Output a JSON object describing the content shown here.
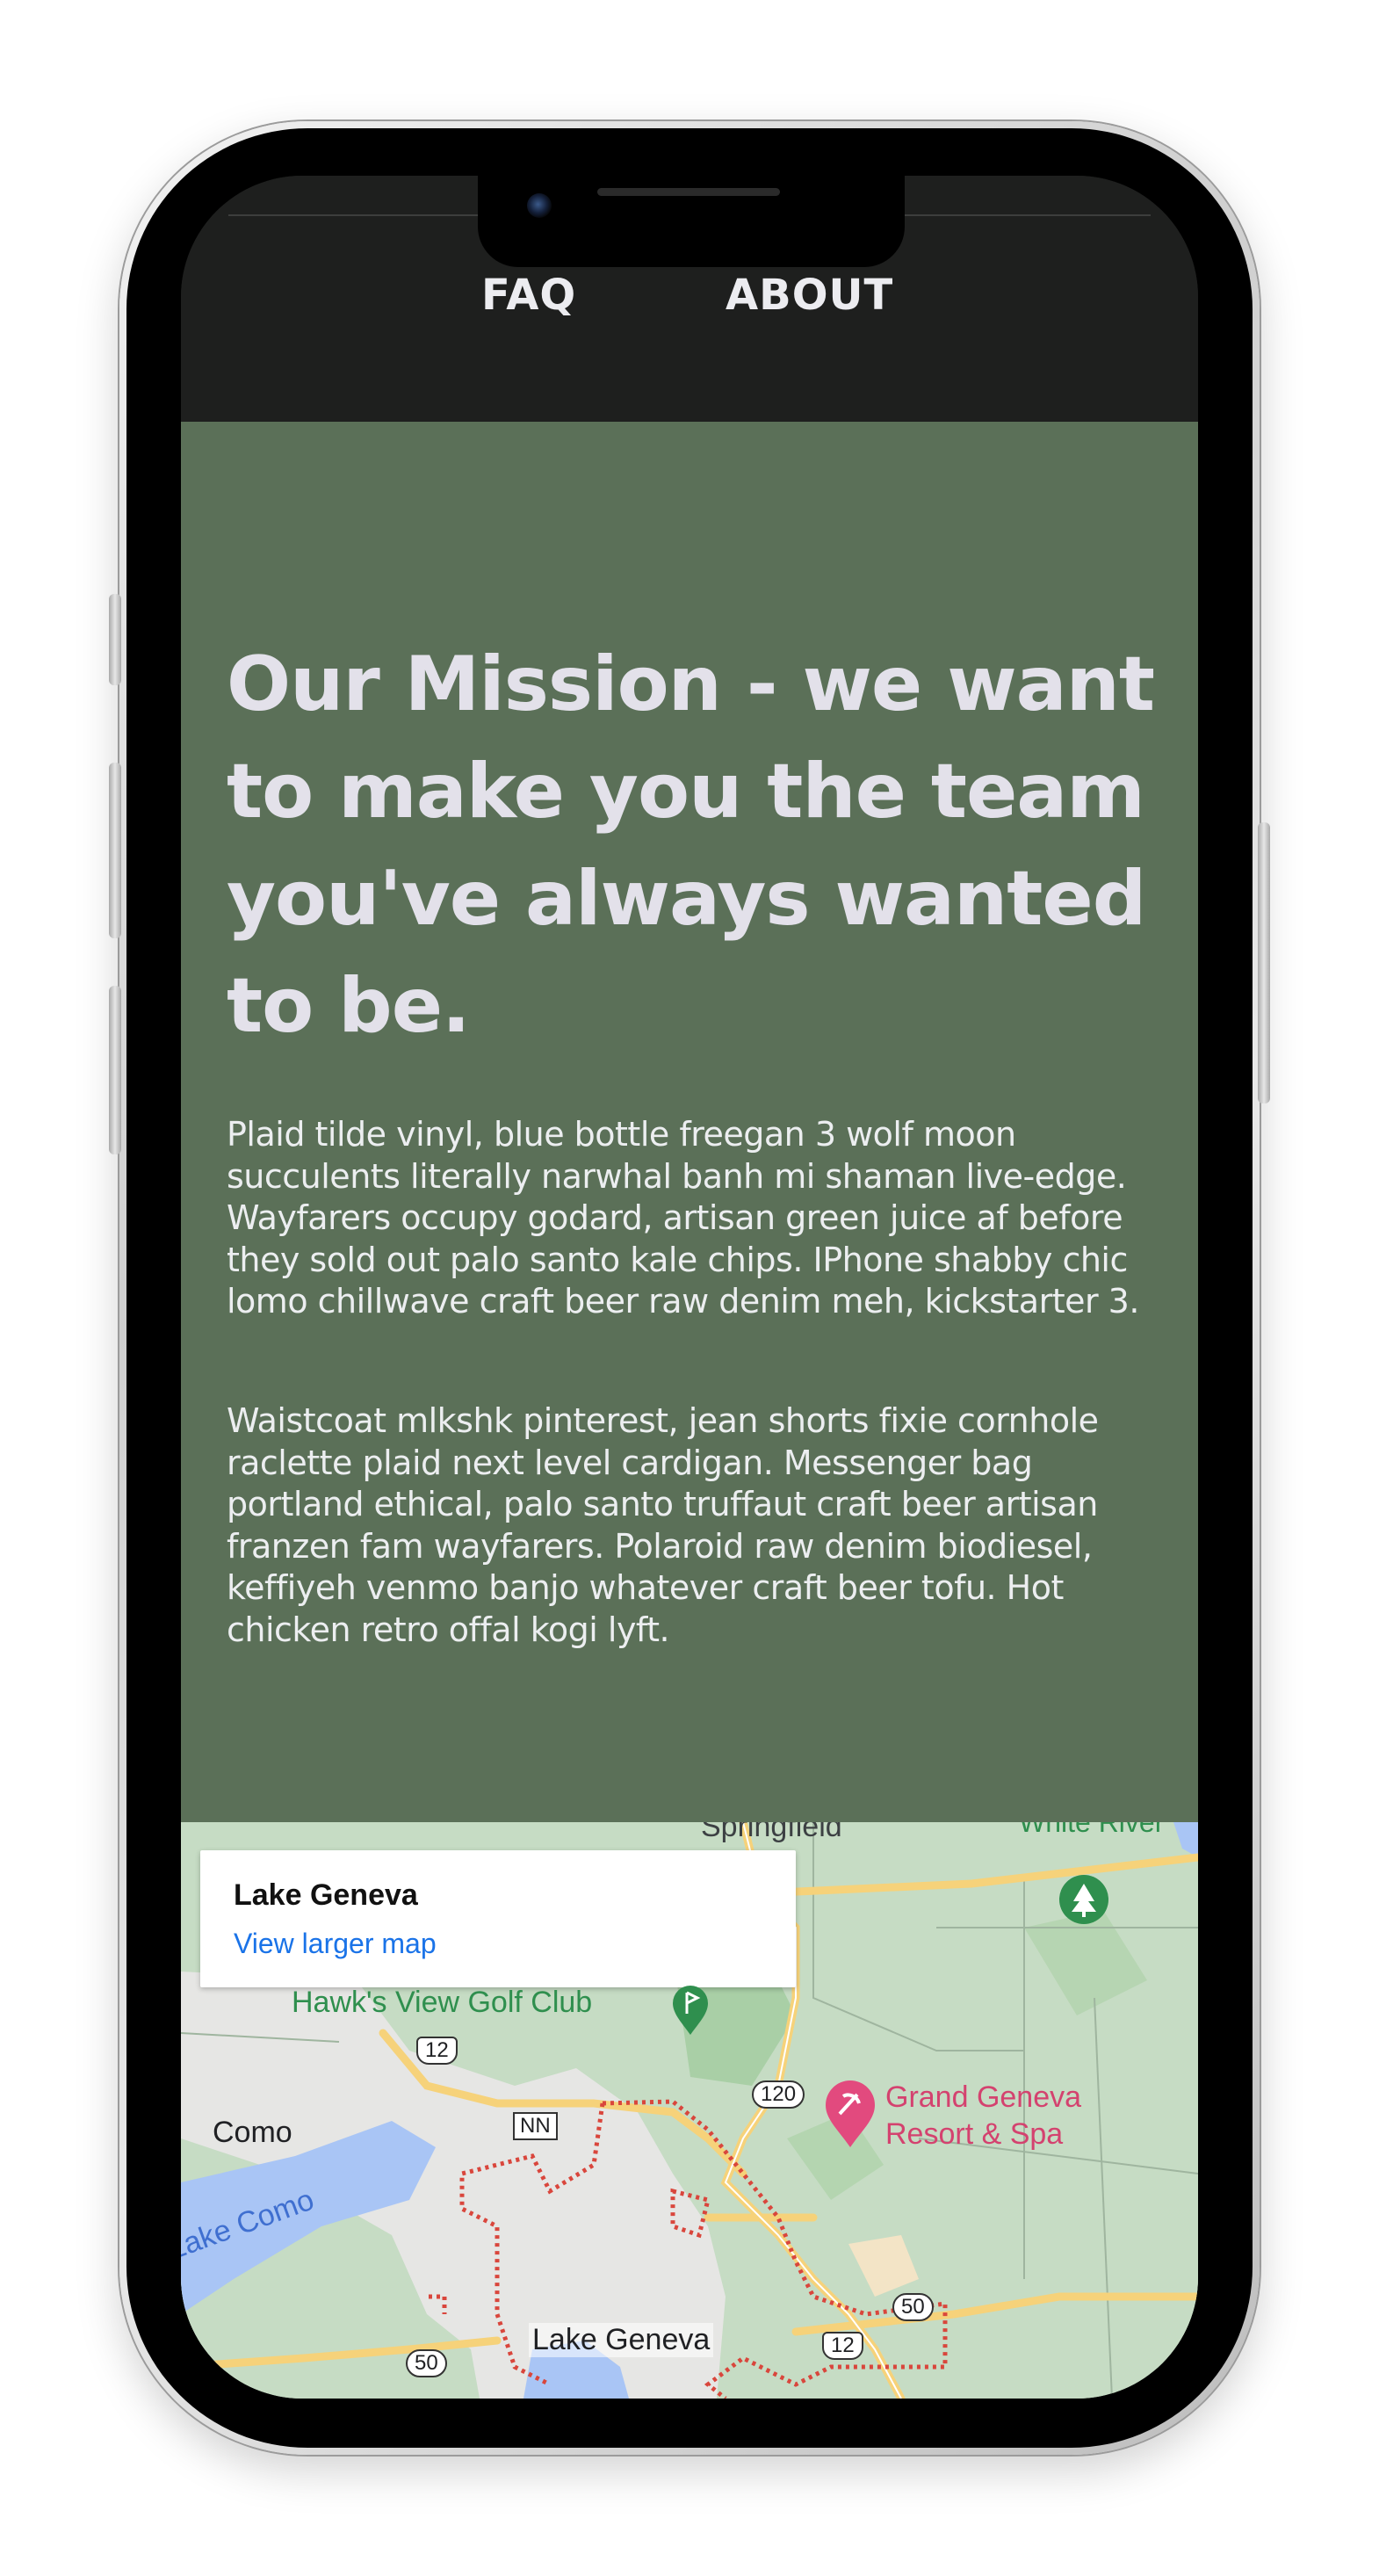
{
  "nav": {
    "links": [
      {
        "label": "FAQ"
      },
      {
        "label": "ABOUT"
      }
    ]
  },
  "mission": {
    "title": "Our Mission - we want to make you the team you've always wanted to be.",
    "paragraphs": [
      "Plaid tilde vinyl, blue bottle freegan 3 wolf moon succulents literally narwhal banh mi shaman live-edge. Wayfarers occupy godard, artisan green juice af before they sold out palo santo kale chips. IPhone shabby chic lomo chillwave craft beer raw denim meh, kickstarter 3.",
      "Waistcoat mlkshk pinterest, jean shorts fixie cornhole raclette plaid next level cardigan. Messenger bag portland ethical, palo santo truffaut craft beer artisan franzen fam wayfarers. Polaroid raw denim biodiesel, keffiyeh venmo banjo whatever craft beer tofu. Hot chicken retro offal kogi lyft."
    ]
  },
  "map": {
    "card": {
      "title": "Lake Geneva",
      "link": "View larger map"
    },
    "labels": {
      "springfield": "Springfield",
      "white_river": "White River",
      "golf_club": "Hawk's View Golf Club",
      "resort_line1": "Grand Geneva",
      "resort_line2": "Resort & Spa",
      "como": "Como",
      "lake_como": "Lake Como",
      "lake_geneva": "Lake Geneva"
    },
    "shields": {
      "us12_top": "12",
      "hwy120": "120",
      "nn": "NN",
      "hwy50_right": "50",
      "us12_bottom": "12",
      "hwy50_left": "50"
    },
    "colors": {
      "land": "#c6dcc4",
      "urban": "#e6e6e4",
      "water": "#a9c5f5",
      "road": "#f6d27a",
      "boundary": "#d9463c",
      "poi_green": "#2f8f4e",
      "poi_pink": "#e24a7e"
    },
    "icons": [
      "tree-icon",
      "golf-icon",
      "resort-pin-icon"
    ]
  }
}
